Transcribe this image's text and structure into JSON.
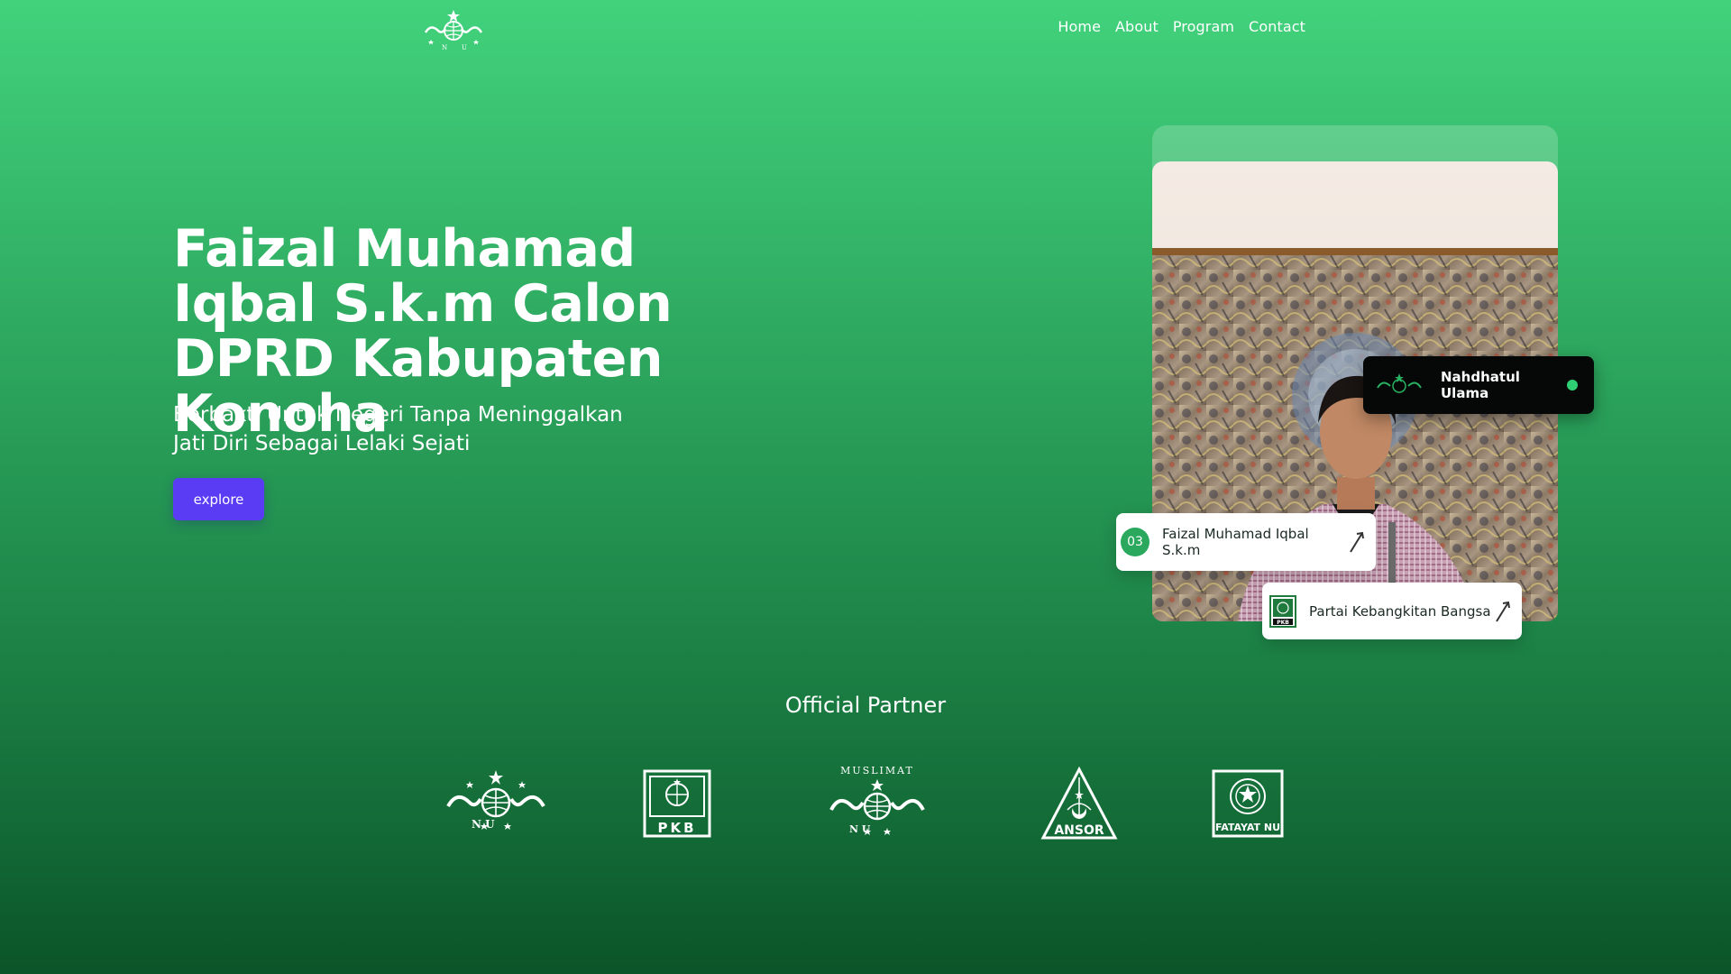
{
  "nav": {
    "logo_icon": "nu-logo-icon",
    "items": [
      {
        "label": "Home"
      },
      {
        "label": "About"
      },
      {
        "label": "Program"
      },
      {
        "label": "Contact"
      }
    ]
  },
  "hero": {
    "title": "Faizal Muhamad Iqbal S.k.m Calon DPRD Kabupaten Konoha",
    "subtitle": "Berbakti Untuk Negeri Tanpa Meninggalkan Jati Diri Sebagai Lelaki Sejati",
    "cta_label": "explore"
  },
  "cards": {
    "org": {
      "label": "Nahdhatul Ulama",
      "icon": "nu-logo-icon",
      "status_color": "#2fcf73"
    },
    "candidate": {
      "number": "03",
      "label": "Faizal Muhamad Iqbal S.k.m",
      "icon": "arrow-icon"
    },
    "party": {
      "label": "Partai Kebangkitan Bangsa",
      "icon": "pkb-logo-icon"
    }
  },
  "partners": {
    "heading": "Official Partner",
    "logos": [
      {
        "name": "nu-logo",
        "text": "N U"
      },
      {
        "name": "pkb-logo",
        "text": "PKB"
      },
      {
        "name": "muslimat-logo",
        "text": "MUSLIMAT",
        "sub": "N U"
      },
      {
        "name": "ansor-logo",
        "text": "ANSOR"
      },
      {
        "name": "fatayat-logo",
        "text": "FATAYAT NU"
      }
    ]
  },
  "colors": {
    "accent_button": "#5b3cf5",
    "background_top": "#42d27c",
    "background_bottom": "#0b5429",
    "badge_green": "#2aa85d"
  }
}
